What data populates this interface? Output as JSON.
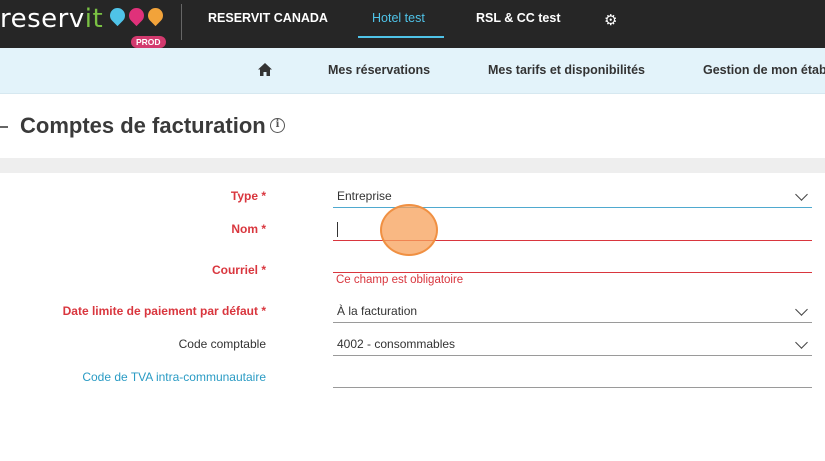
{
  "brand": {
    "name_main": "reserv",
    "name_accent": "it",
    "badge": "PROD",
    "pin_colors": [
      "#4fc3e8",
      "#e0317a",
      "#f2a33a"
    ]
  },
  "topnav": {
    "items": [
      {
        "label": "RESERVIT CANADA",
        "active": false
      },
      {
        "label": "Hotel test",
        "active": true
      },
      {
        "label": "RSL & CC test",
        "active": false
      }
    ],
    "settings_icon": "gear-icon"
  },
  "subnav": {
    "home_icon": "home-icon",
    "items": [
      {
        "label": "Mes réservations"
      },
      {
        "label": "Mes tarifs et disponibilités"
      },
      {
        "label": "Gestion de mon établ"
      }
    ]
  },
  "page": {
    "title": "Comptes de facturation",
    "info_icon": "info-icon"
  },
  "form": {
    "type": {
      "label": "Type *",
      "value": "Entreprise"
    },
    "nom": {
      "label": "Nom *",
      "value": ""
    },
    "courriel": {
      "label": "Courriel *",
      "value": "",
      "error": "Ce champ est obligatoire"
    },
    "date_limite": {
      "label": "Date limite de paiement par défaut *",
      "value": "À la facturation"
    },
    "code_comptable": {
      "label": "Code comptable",
      "value": "4002 - consommables"
    },
    "tva": {
      "label": "Code de TVA intra-communautaire",
      "value": ""
    }
  },
  "colors": {
    "topbar": "#262626",
    "accent": "#4fc3e8",
    "error": "#d9363e",
    "subnav_bg": "#e3f3fa"
  }
}
